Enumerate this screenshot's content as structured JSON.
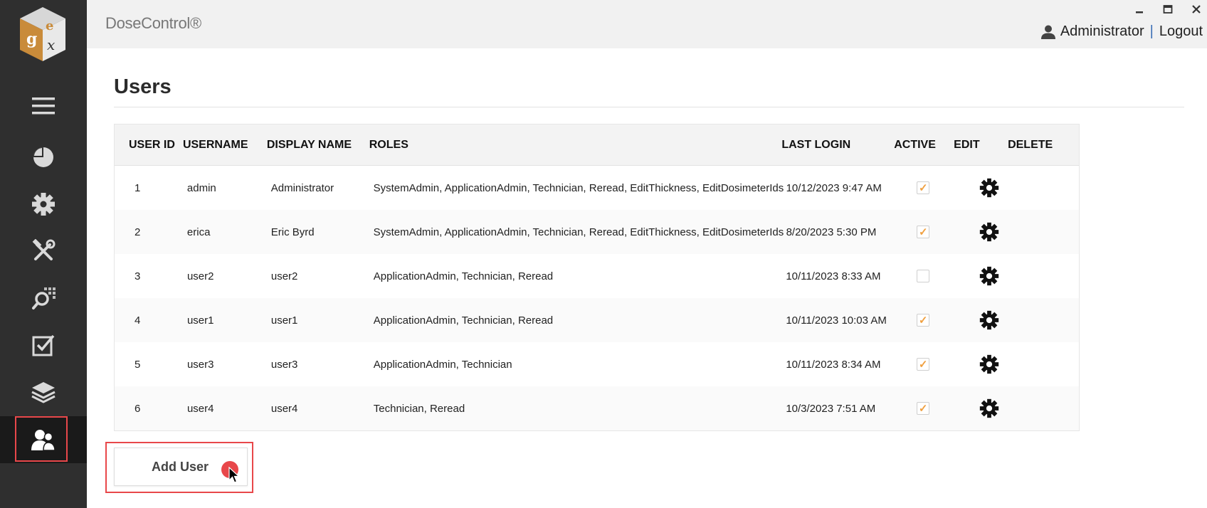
{
  "app": {
    "title": "DoseControl®"
  },
  "logo": {
    "letters": [
      "g",
      "e",
      "x"
    ]
  },
  "header": {
    "user_name": "Administrator",
    "separator": "|",
    "logout_label": "Logout",
    "window_controls": [
      "minimize-icon",
      "maximize-icon",
      "close-icon"
    ]
  },
  "sidebar": {
    "items": [
      {
        "name": "menu",
        "icon": "hamburger-icon"
      },
      {
        "name": "dashboard",
        "icon": "pie-chart-icon"
      },
      {
        "name": "settings",
        "icon": "gear-icon"
      },
      {
        "name": "tools",
        "icon": "tools-icon"
      },
      {
        "name": "search",
        "icon": "search-grid-icon"
      },
      {
        "name": "tasks",
        "icon": "checkbox-icon"
      },
      {
        "name": "layers",
        "icon": "layers-icon"
      },
      {
        "name": "users",
        "icon": "users-icon",
        "active": true
      }
    ]
  },
  "page": {
    "title": "Users"
  },
  "table": {
    "headers": {
      "user_id": "USER ID",
      "username": "USERNAME",
      "display_name": "DISPLAY NAME",
      "roles": "ROLES",
      "last_login": "LAST LOGIN",
      "active": "ACTIVE",
      "edit": "EDIT",
      "delete": "DELETE"
    },
    "rows": [
      {
        "id": "1",
        "username": "admin",
        "display_name": "Administrator",
        "roles": "SystemAdmin, ApplicationAdmin, Technician, Reread, EditThickness, EditDosimeterIds",
        "last_login": "10/12/2023 9:47 AM",
        "active": true
      },
      {
        "id": "2",
        "username": "erica",
        "display_name": "Eric Byrd",
        "roles": "SystemAdmin, ApplicationAdmin, Technician, Reread, EditThickness, EditDosimeterIds",
        "last_login": "8/20/2023 5:30 PM",
        "active": true
      },
      {
        "id": "3",
        "username": "user2",
        "display_name": "user2",
        "roles": "ApplicationAdmin, Technician, Reread",
        "last_login": "10/11/2023 8:33 AM",
        "active": false
      },
      {
        "id": "4",
        "username": "user1",
        "display_name": "user1",
        "roles": "ApplicationAdmin, Technician, Reread",
        "last_login": "10/11/2023 10:03 AM",
        "active": true
      },
      {
        "id": "5",
        "username": "user3",
        "display_name": "user3",
        "roles": "ApplicationAdmin, Technician",
        "last_login": "10/11/2023 8:34 AM",
        "active": true
      },
      {
        "id": "6",
        "username": "user4",
        "display_name": "user4",
        "roles": "Technician, Reread",
        "last_login": "10/3/2023 7:51 AM",
        "active": true
      }
    ]
  },
  "actions": {
    "add_user_label": "Add User"
  },
  "colors": {
    "sidebar_bg": "#2f2f2f",
    "topbar_bg": "#f1f1f1",
    "highlight": "#e8474a",
    "check": "#f0a040",
    "logo_orange": "#c98b3a"
  }
}
